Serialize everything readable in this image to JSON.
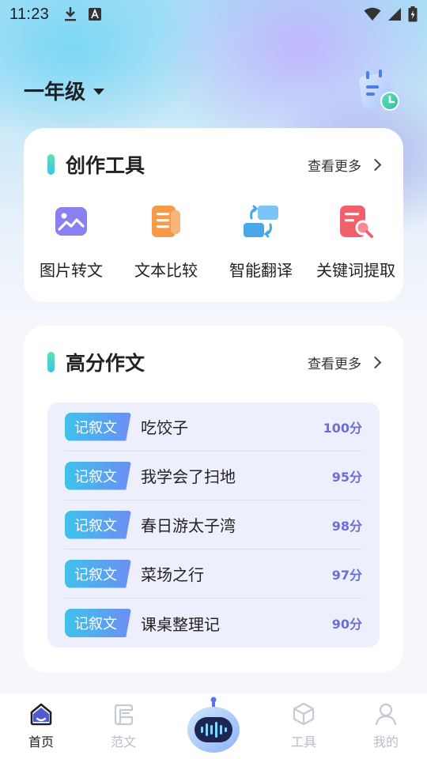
{
  "status_bar": {
    "time": "11:23",
    "icons": [
      "download-icon",
      "translate-a-icon",
      "wifi-icon",
      "signal-icon",
      "battery-charging-icon"
    ]
  },
  "header": {
    "grade": "一年级"
  },
  "tools_card": {
    "title": "创作工具",
    "see_more": "查看更多",
    "tools": [
      {
        "label": "图片转文",
        "icon": "image-icon",
        "color": "#8b80ef"
      },
      {
        "label": "文本比较",
        "icon": "document-icon",
        "color": "#f59a4a"
      },
      {
        "label": "智能翻译",
        "icon": "swap-icon",
        "color": "#4aa7ea"
      },
      {
        "label": "关键词提取",
        "icon": "search-document-icon",
        "color": "#f2606b"
      }
    ]
  },
  "essays_card": {
    "title": "高分作文",
    "see_more": "查看更多",
    "items": [
      {
        "tag": "记叙文",
        "title": "吃饺子",
        "score": "100分"
      },
      {
        "tag": "记叙文",
        "title": "我学会了扫地",
        "score": "95分"
      },
      {
        "tag": "记叙文",
        "title": "春日游太子湾",
        "score": "98分"
      },
      {
        "tag": "记叙文",
        "title": "菜场之行",
        "score": "97分"
      },
      {
        "tag": "记叙文",
        "title": "课桌整理记",
        "score": "90分"
      }
    ]
  },
  "tabbar": {
    "tabs": [
      {
        "label": "首页",
        "icon": "home-icon",
        "active": true
      },
      {
        "label": "范文",
        "icon": "essay-icon",
        "active": false
      },
      {
        "label": "",
        "icon": "robot-assistant-icon",
        "active": false
      },
      {
        "label": "工具",
        "icon": "cube-icon",
        "active": false
      },
      {
        "label": "我的",
        "icon": "profile-icon",
        "active": false
      }
    ]
  },
  "colors": {
    "accent": "#6a6fd6",
    "tag_gradient_start": "#3fc2ea",
    "tag_gradient_end": "#6c8ef3",
    "inactive_tab": "#b8bcc6"
  }
}
